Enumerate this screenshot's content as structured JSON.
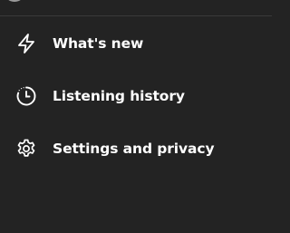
{
  "menu": {
    "items": [
      {
        "label": "What's new",
        "icon": "lightning-bolt-icon"
      },
      {
        "label": "Listening history",
        "icon": "clock-history-icon"
      },
      {
        "label": "Settings and privacy",
        "icon": "gear-icon"
      }
    ]
  },
  "colors": {
    "background": "#232323",
    "text": "#ffffff",
    "divider": "#3a3a3a"
  }
}
